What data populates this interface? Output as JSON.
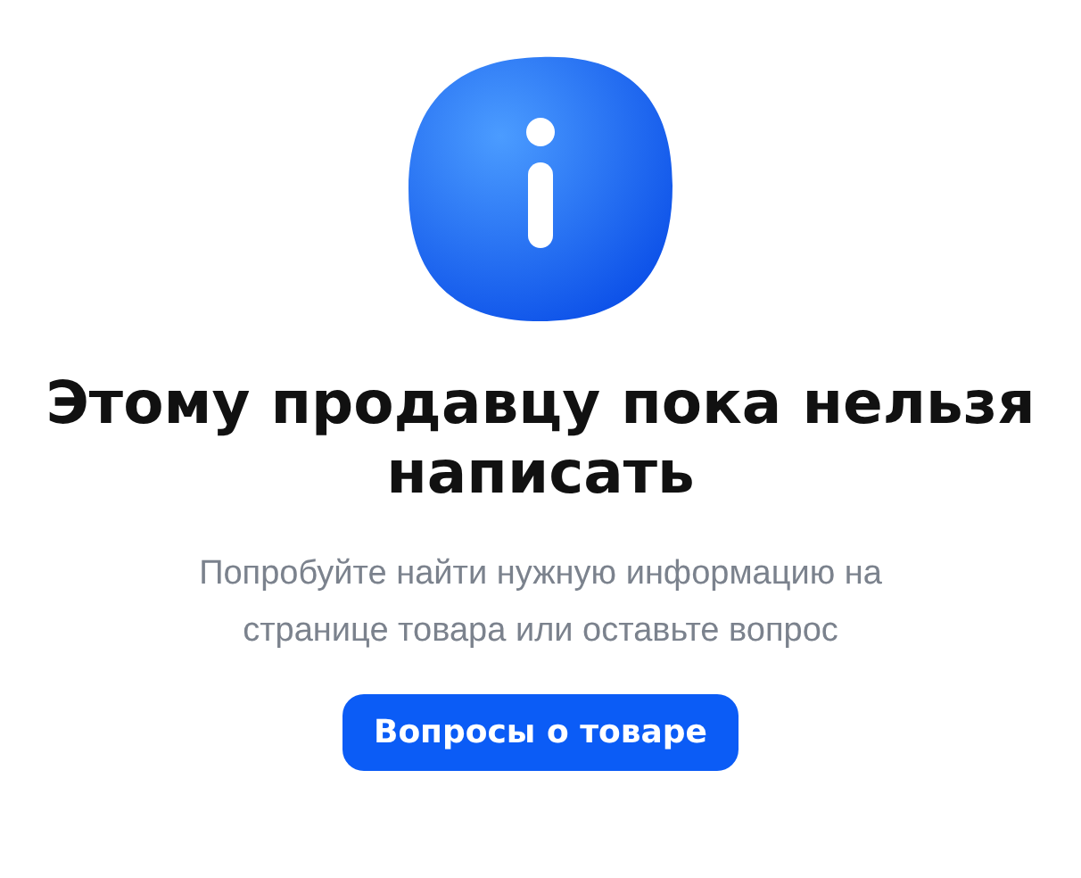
{
  "title": "Этому продавцу пока нельзя написать",
  "message": "Попробуйте найти нужную информацию на странице товара или оставьте вопрос",
  "button": {
    "label": "Вопросы о товаре"
  }
}
